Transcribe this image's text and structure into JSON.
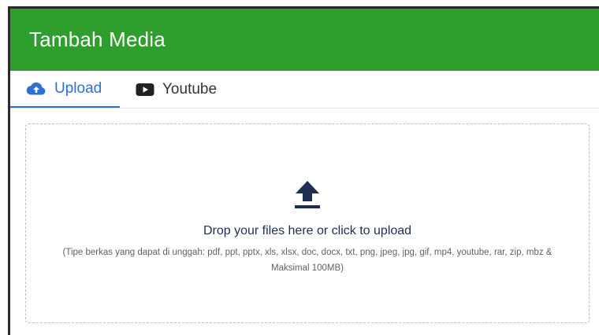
{
  "header": {
    "title": "Tambah Media",
    "color": "#2e9e2c"
  },
  "tabs": [
    {
      "label": "Upload",
      "icon": "cloud-upload-icon",
      "active": true
    },
    {
      "label": "Youtube",
      "icon": "youtube-icon",
      "active": false
    }
  ],
  "dropzone": {
    "icon": "upload-arrow-icon",
    "main_text": "Drop your files here or click to upload",
    "hint_text": "(Tipe berkas yang dapat di unggah: pdf, ppt, pptx, xls, xlsx, doc, docx, txt, png, jpeg, jpg, gif, mp4, youtube, rar, zip, mbz & Maksimal 100MB)"
  },
  "colors": {
    "accent": "#2e6fd1",
    "icon_dark": "#1f2f52"
  }
}
